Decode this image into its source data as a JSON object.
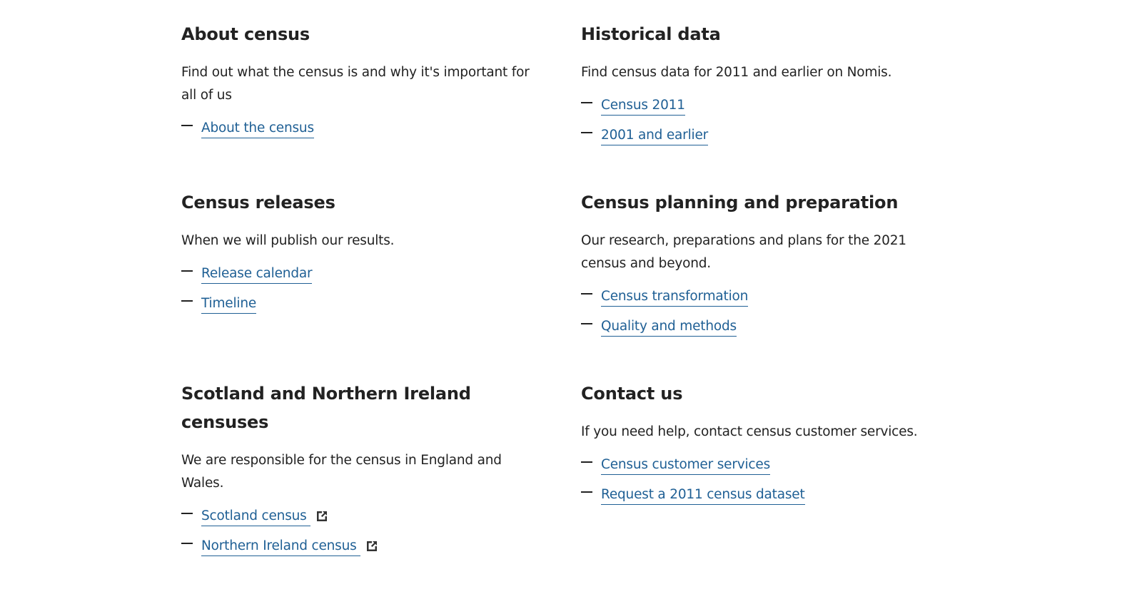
{
  "sections": [
    {
      "title": "About census",
      "description": "Find out what the census is and why it's important for all of us",
      "links": [
        {
          "label": "About the census",
          "external": false
        }
      ]
    },
    {
      "title": "Historical data",
      "description": "Find census data for 2011 and earlier on Nomis.",
      "links": [
        {
          "label": "Census 2011",
          "external": false
        },
        {
          "label": "2001 and earlier",
          "external": false
        }
      ]
    },
    {
      "title": "Census releases",
      "description": "When we will publish our results.",
      "links": [
        {
          "label": "Release calendar",
          "external": false
        },
        {
          "label": "Timeline",
          "external": false
        }
      ]
    },
    {
      "title": "Census planning and preparation",
      "description": "Our research, preparations and plans for the 2021 census and beyond.",
      "links": [
        {
          "label": "Census transformation",
          "external": false
        },
        {
          "label": "Quality and methods",
          "external": false
        }
      ]
    },
    {
      "title": "Scotland and Northern Ireland censuses",
      "description": "We are responsible for the census in England and Wales.",
      "links": [
        {
          "label": "Scotland census",
          "external": true,
          "icon": "external-link-icon"
        },
        {
          "label": "Northern Ireland census",
          "external": true,
          "icon": "external-link-icon"
        }
      ]
    },
    {
      "title": "Contact us",
      "description": "If you need help, contact census customer services.",
      "links": [
        {
          "label": "Census customer services",
          "external": false
        },
        {
          "label": "Request a 2011 census dataset",
          "external": false
        }
      ]
    }
  ],
  "colors": {
    "link": "#206095",
    "text": "#222222"
  }
}
